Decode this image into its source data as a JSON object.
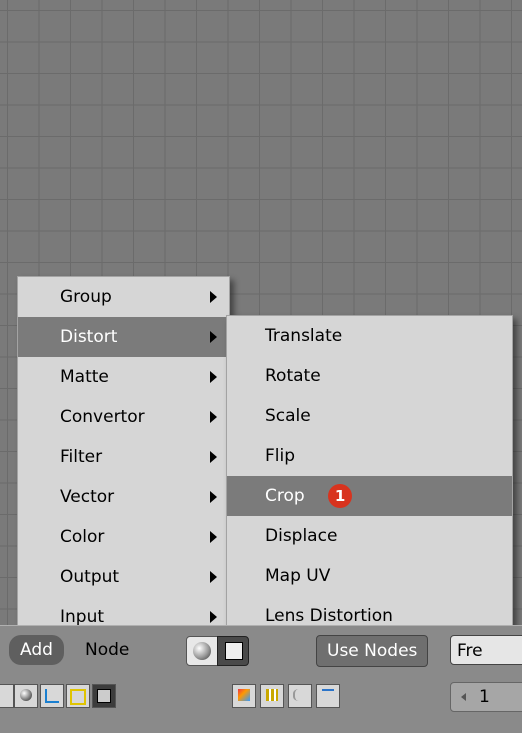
{
  "main_menu": {
    "items": [
      {
        "label": "Group",
        "submenu": true,
        "highlighted": false
      },
      {
        "label": "Distort",
        "submenu": true,
        "highlighted": true
      },
      {
        "label": "Matte",
        "submenu": true,
        "highlighted": false
      },
      {
        "label": "Convertor",
        "submenu": true,
        "highlighted": false
      },
      {
        "label": "Filter",
        "submenu": true,
        "highlighted": false
      },
      {
        "label": "Vector",
        "submenu": true,
        "highlighted": false
      },
      {
        "label": "Color",
        "submenu": true,
        "highlighted": false
      },
      {
        "label": "Output",
        "submenu": true,
        "highlighted": false
      },
      {
        "label": "Input",
        "submenu": true,
        "highlighted": false
      }
    ]
  },
  "submenu": {
    "items": [
      {
        "label": "Translate"
      },
      {
        "label": "Rotate"
      },
      {
        "label": "Scale"
      },
      {
        "label": "Flip"
      },
      {
        "label": "Crop",
        "highlighted": true,
        "badge": "1"
      },
      {
        "label": "Displace"
      },
      {
        "label": "Map UV"
      },
      {
        "label": "Lens Distortion"
      }
    ]
  },
  "header": {
    "add_label": "Add",
    "node_label": "Node",
    "use_nodes_label": "Use Nodes",
    "fre_label": "Fre"
  },
  "toolbar": {
    "frame_value": "1"
  },
  "colors": {
    "highlight": "#7b7b7b",
    "badge": "#d8331e",
    "menu_bg": "#d6d6d6"
  }
}
